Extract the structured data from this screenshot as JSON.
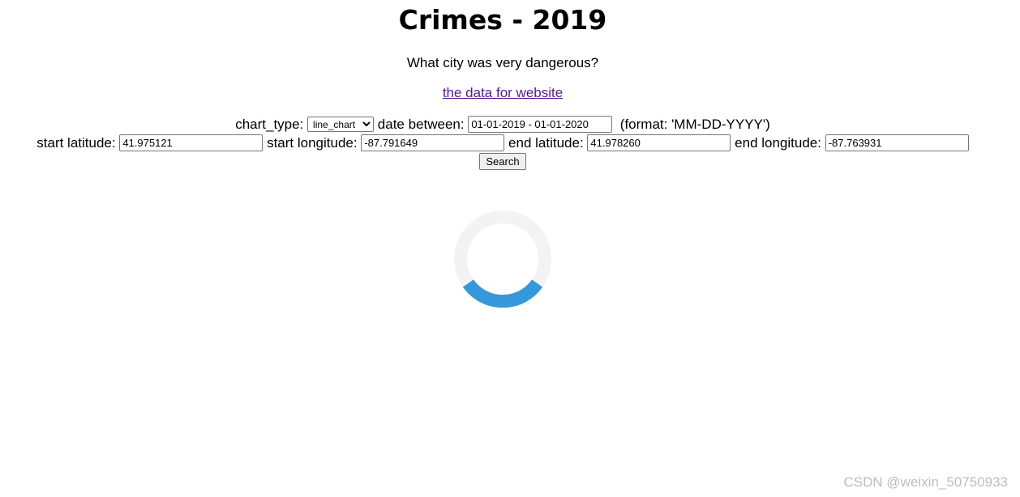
{
  "header": {
    "title": "Crimes - 2019",
    "subtitle": "What city was very dangerous?",
    "data_link": "the data for website"
  },
  "form": {
    "chart_type_label": "chart_type:",
    "chart_type_value": "line_chart",
    "date_label": "date between:",
    "date_value": "01-01-2019 - 01-01-2020",
    "date_format_note": "(format: 'MM-DD-YYYY')",
    "start_lat_label": "start latitude:",
    "start_lat_value": "41.975121",
    "start_lon_label": "start longitude:",
    "start_lon_value": "-87.791649",
    "end_lat_label": "end latitude:",
    "end_lat_value": "41.978260",
    "end_lon_label": "end longitude:",
    "end_lon_value": "-87.763931",
    "search_label": "Search"
  },
  "spinner": {
    "track_color": "#f3f3f3",
    "arc_color": "#3498db"
  },
  "watermark": "CSDN @weixin_50750933"
}
